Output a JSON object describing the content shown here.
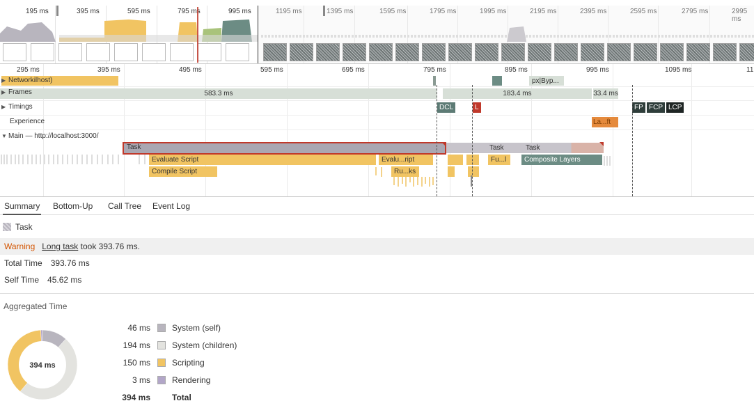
{
  "overview": {
    "ticks": [
      "195 ms",
      "395 ms",
      "595 ms",
      "795 ms",
      "995 ms",
      "1195 ms",
      "1395 ms",
      "1595 ms",
      "1795 ms",
      "1995 ms",
      "2195 ms",
      "2395 ms",
      "2595 ms",
      "2795 ms",
      "2995 ms"
    ]
  },
  "flame": {
    "ticks": [
      "295 ms",
      "395 ms",
      "495 ms",
      "595 ms",
      "695 ms",
      "795 ms",
      "895 ms",
      "995 ms",
      "1095 ms",
      "11"
    ],
    "tracks": {
      "network": "Network",
      "network_suffix": "ilhost)",
      "frames": "Frames",
      "timings": "Timings",
      "experience": "Experience",
      "main": "Main — http://localhost:3000/"
    },
    "network_item": "px|Byp...",
    "frames": [
      "583.3 ms",
      "183.4 ms",
      "33.4 ms"
    ],
    "timings": {
      "dcl": "DCL",
      "l": "L",
      "fp": "FP",
      "fcp": "FCP",
      "lcp": "LCP"
    },
    "experience_chip": "La...ft",
    "main": {
      "task_selected": "Task",
      "task_2": "Task",
      "task_3": "Task",
      "evaluate_script": "Evaluate Script",
      "compile_script": "Compile Script",
      "evalu_script": "Evalu...ript",
      "ru_ks": "Ru...ks",
      "fu_l": "Fu...l",
      "composite_layers": "Composite Layers"
    }
  },
  "tabs": [
    "Summary",
    "Bottom-Up",
    "Call Tree",
    "Event Log"
  ],
  "active_tab": "Summary",
  "details": {
    "title": "Task",
    "warning_label": "Warning",
    "warning_link": "Long task",
    "warning_text": " took 393.76 ms.",
    "total_time_label": "Total Time",
    "total_time_value": "393.76 ms",
    "self_time_label": "Self Time",
    "self_time_value": "45.62 ms",
    "aggregated_title": "Aggregated Time",
    "donut_center": "394 ms",
    "breakdown": [
      {
        "value": "46 ms",
        "label": "System (self)",
        "color": "#b8b5be",
        "ms": 46
      },
      {
        "value": "194 ms",
        "label": "System (children)",
        "color": "#e3e3df",
        "ms": 194
      },
      {
        "value": "150 ms",
        "label": "Scripting",
        "color": "#f1c462",
        "ms": 150
      },
      {
        "value": "3 ms",
        "label": "Rendering",
        "color": "#b2a6c8",
        "ms": 3
      }
    ],
    "total_value": "394 ms",
    "total_label": "Total"
  },
  "colors": {
    "scripting": "#f1c462",
    "system": "#b8b5be",
    "rendering": "#b2a6c8",
    "selected_border": "#c0392b",
    "warning": "#d35400"
  }
}
